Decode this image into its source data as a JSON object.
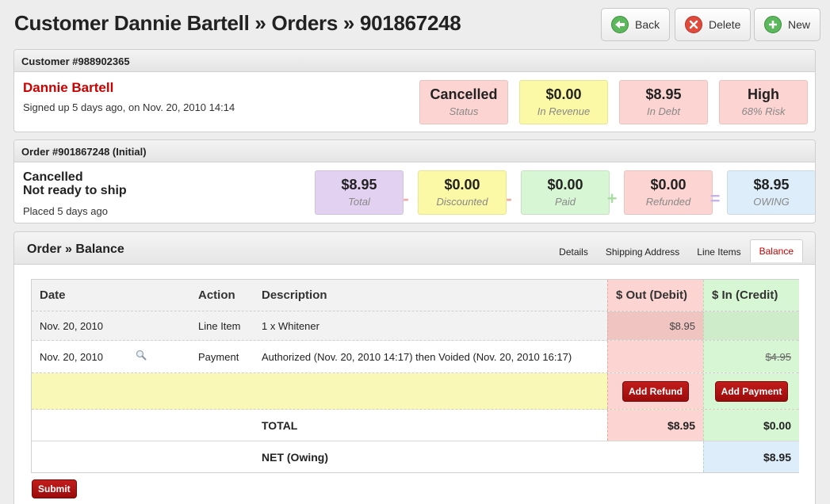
{
  "page": {
    "title": "Customer Dannie Bartell » Orders » 901867248",
    "buttons": {
      "back": "Back",
      "delete": "Delete",
      "new": "New"
    }
  },
  "customer": {
    "header": "Customer #988902365",
    "name": "Dannie Bartell",
    "signup": "Signed up 5 days ago, on Nov. 20, 2010 14:14",
    "stats": [
      {
        "value": "Cancelled",
        "label": "Status",
        "color": "#fcd4d1"
      },
      {
        "value": "$0.00",
        "label": "In Revenue",
        "color": "#fbf9a5"
      },
      {
        "value": "$8.95",
        "label": "In Debt",
        "color": "#fcd4d1"
      },
      {
        "value": "High",
        "label": "68% Risk",
        "color": "#fcd4d1"
      }
    ]
  },
  "order": {
    "header": "Order #901867248 (Initial)",
    "status_line1": "Cancelled",
    "status_line2": "Not ready to ship",
    "placed": "Placed 5 days ago",
    "stats": [
      {
        "value": "$8.95",
        "label": "Total",
        "color": "#e3d1f1"
      },
      {
        "value": "$0.00",
        "label": "Discounted",
        "color": "#fbf9a5"
      },
      {
        "value": "$0.00",
        "label": "Paid",
        "color": "#d7f6d3"
      },
      {
        "value": "$0.00",
        "label": "Refunded",
        "color": "#fcd4d1"
      },
      {
        "value": "$8.95",
        "label": "OWING",
        "color": "#ddeefa"
      }
    ],
    "operators": [
      "-",
      "-",
      "+",
      "="
    ]
  },
  "balance": {
    "title_part1": "Order",
    "separator": "»",
    "title_part2": "Balance",
    "tabs": [
      "Details",
      "Shipping Address",
      "Line Items",
      "Balance"
    ],
    "active_tab": "Balance",
    "columns": {
      "date": "Date",
      "action": "Action",
      "description": "Description",
      "out": "$ Out (Debit)",
      "in": "$ In (Credit)"
    },
    "rows": [
      {
        "date": "Nov. 20, 2010",
        "action": "Line Item",
        "description": "1 x Whitener",
        "out": "$8.95",
        "in": ""
      },
      {
        "date": "Nov. 20, 2010",
        "action": "Payment",
        "description": "Authorized (Nov. 20, 2010 14:17) then Voided (Nov. 20, 2010 16:17)",
        "out": "",
        "in": "$4.95"
      }
    ],
    "add_refund": "Add Refund",
    "add_payment": "Add Payment",
    "total_label": "TOTAL",
    "total_out": "$8.95",
    "total_in": "$0.00",
    "net_label": "NET (Owing)",
    "net_value": "$8.95",
    "submit": "Submit"
  }
}
